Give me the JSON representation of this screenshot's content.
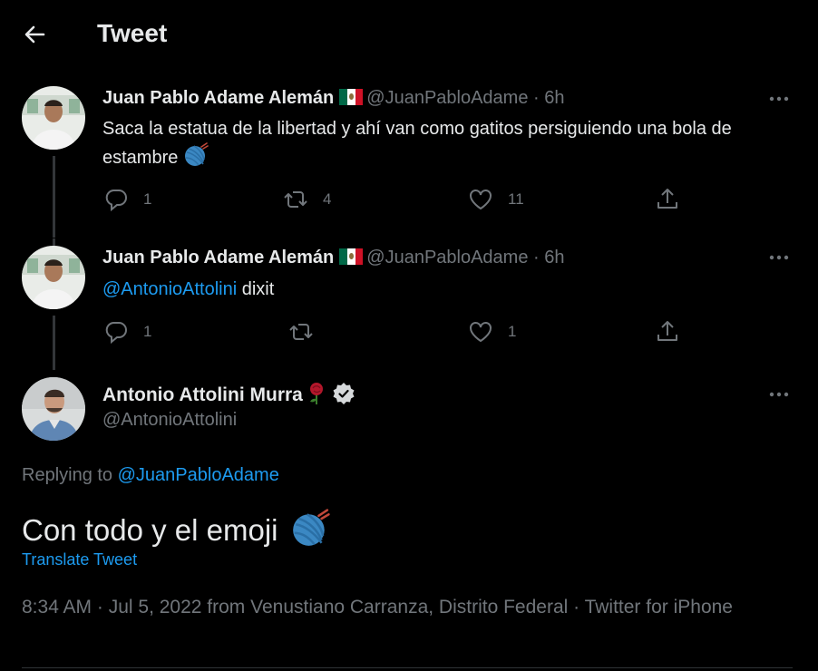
{
  "header": {
    "title": "Tweet"
  },
  "thread": [
    {
      "name": "Juan Pablo Adame Alemán",
      "handle": "@JuanPabloAdame",
      "sep": " · ",
      "time": "6h",
      "text_parts": [
        "Saca la estatua de la libertad y ahí van como gatitos persiguiendo una bola de estambre"
      ],
      "replies": "1",
      "retweets": "4",
      "likes": "11"
    },
    {
      "name": "Juan Pablo Adame Alemán",
      "handle": "@JuanPabloAdame",
      "sep": " · ",
      "time": "6h",
      "mention": "@AntonioAttolini",
      "text": " dixit",
      "replies": "1",
      "retweets": "",
      "likes": "1"
    }
  ],
  "main_tweet": {
    "name": "Antonio Attolini Murra",
    "handle": "@AntonioAttolini",
    "replying_prefix": "Replying to ",
    "replying_handle": "@JuanPabloAdame",
    "text": "Con todo y el emoji",
    "translate": "Translate Tweet",
    "timestamp_line": "8:34 AM · Jul 5, 2022 from Venustiano Carranza, Distrito Federal · Twitter for iPhone"
  },
  "colors": {
    "background": "#000000",
    "accent": "#1d9bf0",
    "muted": "#71767b",
    "text": "#e7e9ea"
  },
  "icons": [
    "back-arrow-icon",
    "mexico-flag-icon",
    "more-icon",
    "reply-icon",
    "retweet-icon",
    "like-icon",
    "share-icon",
    "yarn-emoji-icon",
    "rose-emoji-icon",
    "verified-badge-icon"
  ]
}
